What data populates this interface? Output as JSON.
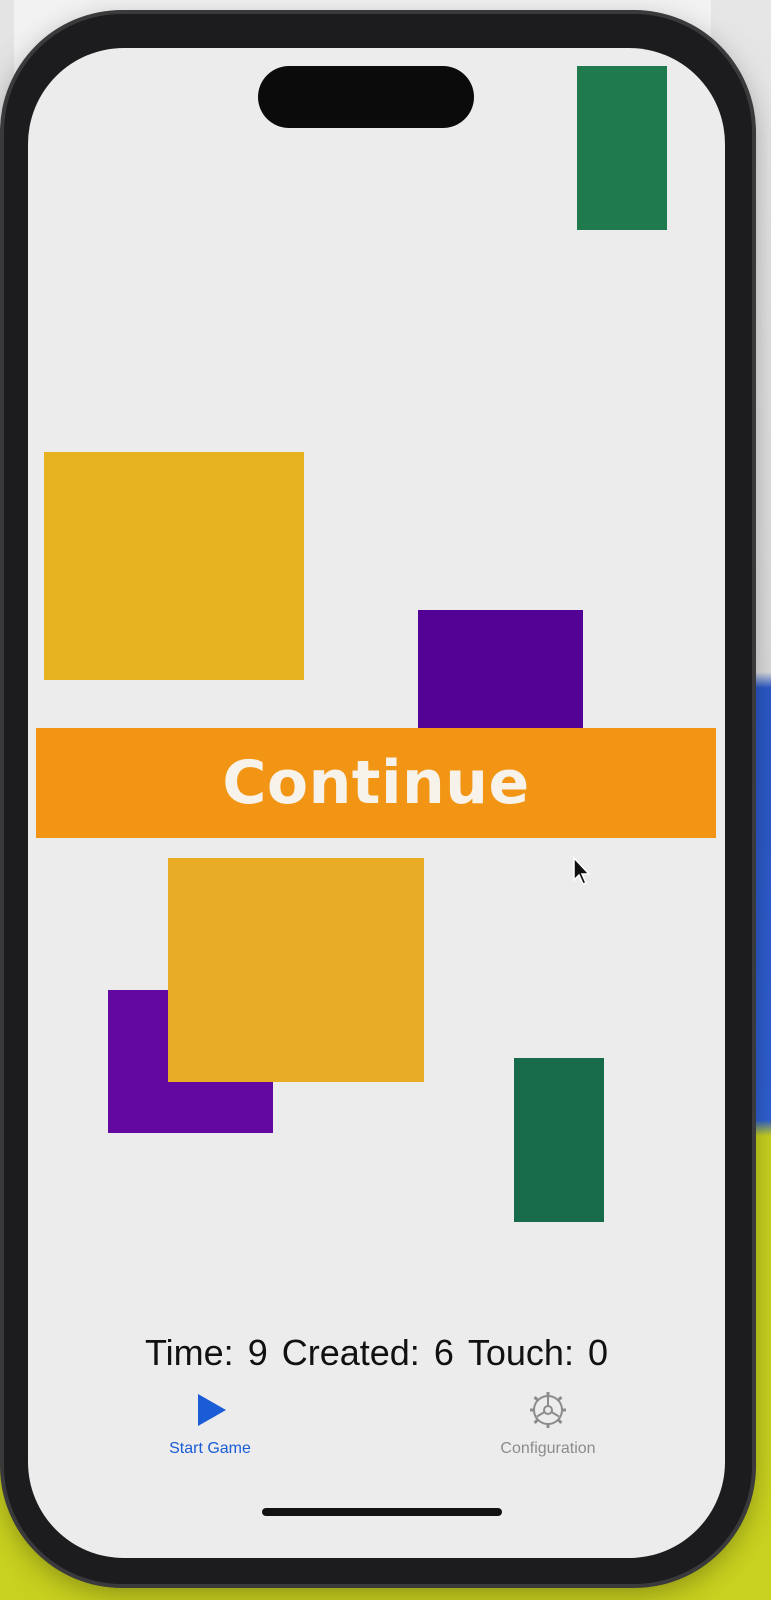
{
  "game": {
    "continue_label": "Continue",
    "stats": {
      "time_label": "Time:",
      "time_value": "9",
      "created_label": "Created:",
      "created_value": "6",
      "touch_label": "Touch:",
      "touch_value": "0"
    }
  },
  "tabbar": {
    "items": [
      {
        "label": "Start Game",
        "icon": "play-icon",
        "active": true
      },
      {
        "label": "Configuration",
        "icon": "gear-icon",
        "active": false
      }
    ]
  },
  "colors": {
    "continue_bar": "#f39514",
    "yellow": "#e6b21f",
    "purple": "#530295",
    "green": "#1f7a4e",
    "tab_active": "#1a5bd6",
    "tab_inactive": "#8c8c8c"
  }
}
